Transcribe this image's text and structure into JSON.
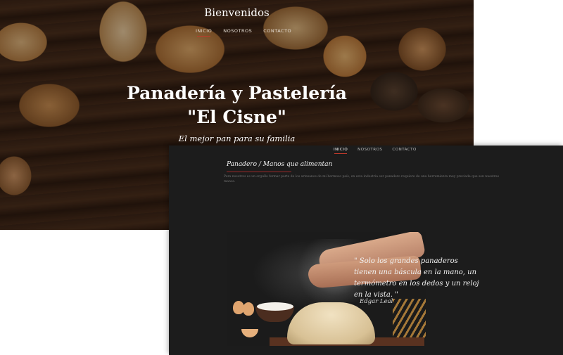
{
  "hero": {
    "brand": "Bienvenidos",
    "nav": [
      "INICIO",
      "NOSOTROS",
      "CONTACTO"
    ],
    "title_line1": "Panadería y Pastelería",
    "title_line2": "\"El Cisne\"",
    "subtitle": "El mejor pan para su familia"
  },
  "dark": {
    "nav": [
      "INICIO",
      "NOSOTROS",
      "CONTACTO"
    ],
    "section_title": "Panadero / Manos que alimentan",
    "section_text": "Para nosotros es un orgullo formar parte de los artesanos de mi hermoso país, en esta industria ser panadero requiere de una herramienta muy preciada que son nuestras manos.",
    "quote": "\" Solo los grandes panaderos tienen una báscula en la mano, un termómetro en los dedos y un reloj en la vista. \"",
    "quote_author": "Edgar Leal"
  },
  "colors": {
    "accent": "#c0392b",
    "dark_bg": "#1c1c1c",
    "hero_overlay": "#3a2415"
  }
}
